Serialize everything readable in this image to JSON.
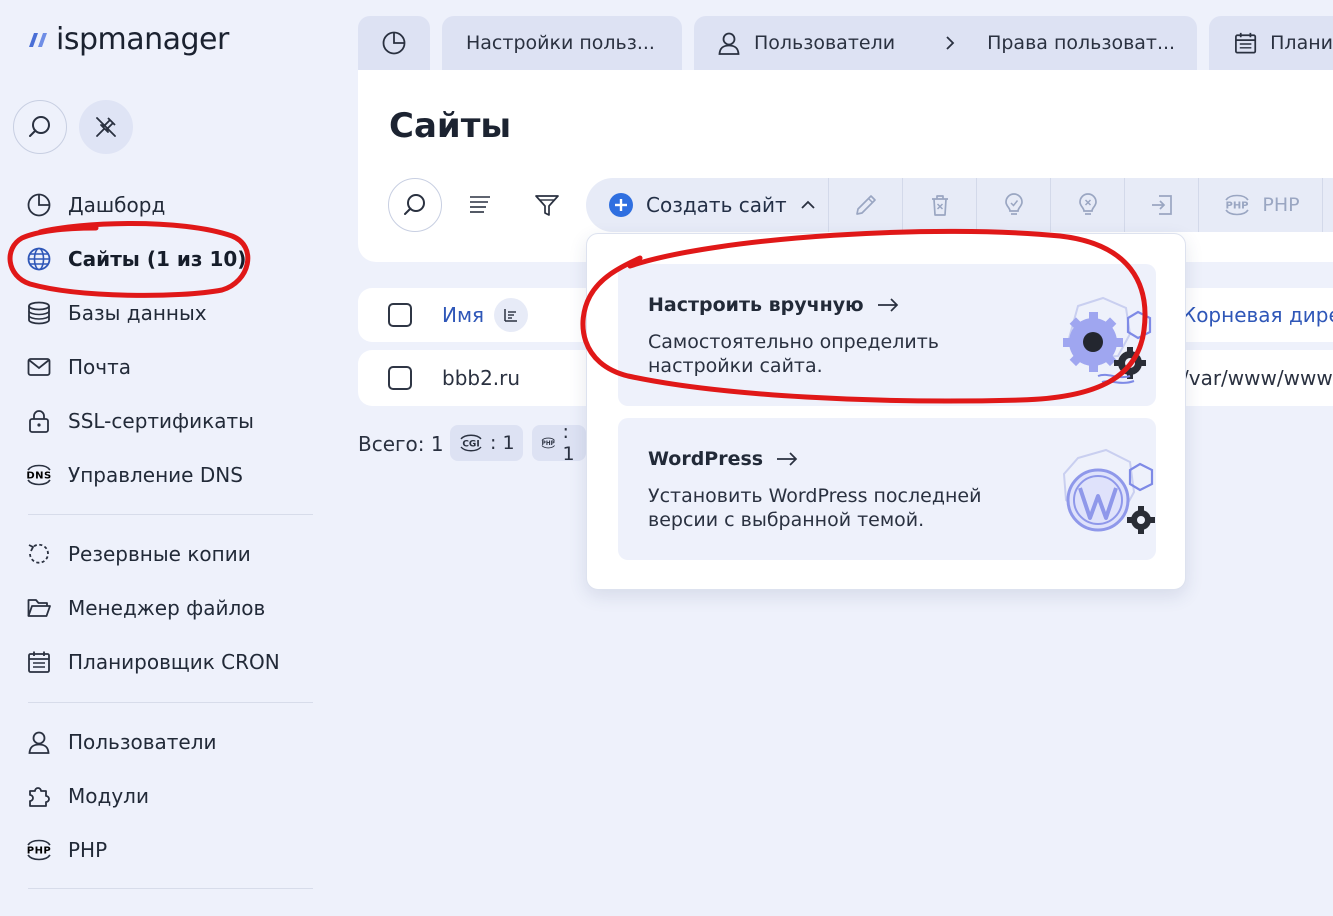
{
  "logo": {
    "text": "ispmanager"
  },
  "sidebar": {
    "items": [
      {
        "label": "Дашборд",
        "icon": "pie-chart-icon"
      },
      {
        "label": "Сайты (1 из 10)",
        "icon": "globe-icon",
        "active": true
      },
      {
        "label": "Базы данных",
        "icon": "database-icon"
      },
      {
        "label": "Почта",
        "icon": "mail-icon"
      },
      {
        "label": "SSL-сертификаты",
        "icon": "lock-icon"
      },
      {
        "label": "Управление DNS",
        "icon": "dns-icon"
      },
      {
        "label": "Резервные копии",
        "icon": "backup-icon"
      },
      {
        "label": "Менеджер файлов",
        "icon": "folder-icon"
      },
      {
        "label": "Планировщик CRON",
        "icon": "calendar-icon"
      },
      {
        "label": "Пользователи",
        "icon": "user-icon"
      },
      {
        "label": "Модули",
        "icon": "puzzle-icon"
      },
      {
        "label": "PHP",
        "icon": "php-icon"
      }
    ],
    "dns_badge": "DNS",
    "php_badge": "PHP"
  },
  "tabs": {
    "settings": "Настройки польз...",
    "users": "Пользователи",
    "rights": "Права пользоват...",
    "planner": "Плани"
  },
  "main": {
    "title": "Сайты",
    "create_label": "Создать сайт",
    "php_label": "PHP",
    "php_badge": "PHP",
    "table": {
      "col_name": "Имя",
      "col_root": "Корневая дирек",
      "rows": [
        {
          "name": "bbb2.ru",
          "root": "/var/www/www-"
        }
      ]
    },
    "footer": {
      "total": "Всего: 1",
      "cgi_badge": "CGI",
      "cgi_count": ": 1",
      "php_badge": "PHP",
      "php_count": ": 1"
    }
  },
  "dropdown": {
    "manual": {
      "title": "Настроить вручную",
      "desc": "Самостоятельно определить настройки сайта."
    },
    "wordpress": {
      "title": "WordPress",
      "desc": "Установить WordPress последней версии с выбранной темой."
    }
  },
  "colors": {
    "background": "#eef1fb",
    "accent": "#2f57b8",
    "create_icon": "#2f6fe0",
    "annotation": "#e01818"
  }
}
